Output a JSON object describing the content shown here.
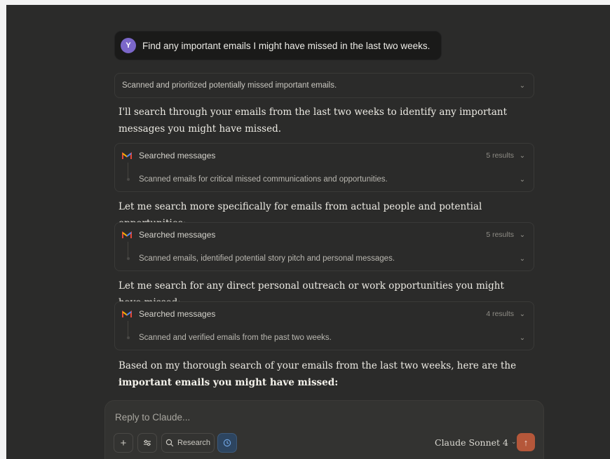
{
  "user": {
    "avatar_letter": "Y",
    "message": "Find any important emails I might have missed in the last two weeks."
  },
  "thinking": {
    "summary": "Scanned and prioritized potentially missed important emails."
  },
  "prose": {
    "p1": "I'll search through your emails from the last two weeks to identify any important messages you might have missed.",
    "p2": "Let me search more specifically for emails from actual people and potential opportunities:",
    "p3": "Let me search for any direct personal outreach or work opportunities you might have missed:",
    "p4_start": "Based on my thorough search of your emails from the last two weeks, here are the ",
    "p4_bold": "important emails you might have missed",
    "p4_end": ":"
  },
  "tool_calls": [
    {
      "title": "Searched messages",
      "count": "5 results",
      "summary": "Scanned emails for critical missed communications and opportunities."
    },
    {
      "title": "Searched messages",
      "count": "5 results",
      "summary": "Scanned emails, identified potential story pitch and personal messages."
    },
    {
      "title": "Searched messages",
      "count": "4 results",
      "summary": "Scanned and verified emails from the past two weeks."
    }
  ],
  "composer": {
    "placeholder": "Reply to Claude...",
    "research_label": "Research",
    "model_label": "Claude Sonnet 4"
  },
  "colors": {
    "accent_send": "#b5573a",
    "avatar": "#7b67c9"
  }
}
